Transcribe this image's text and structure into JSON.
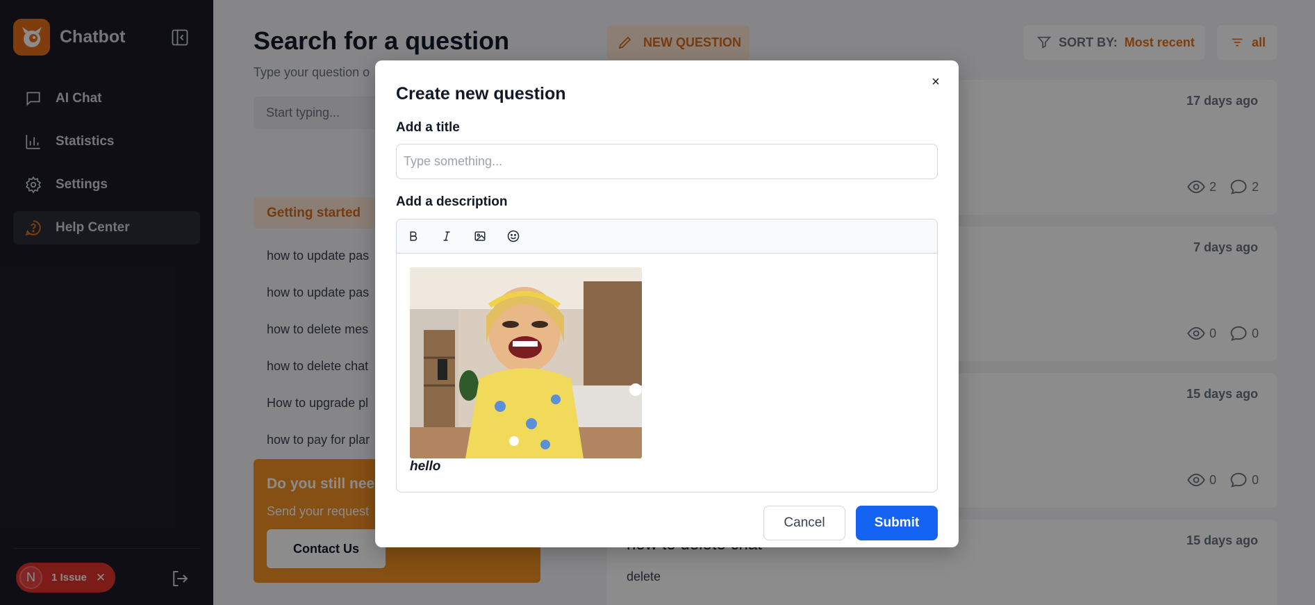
{
  "sidebar": {
    "brand": "Chatbot",
    "items": [
      {
        "label": "AI Chat",
        "icon": "chat-icon"
      },
      {
        "label": "Statistics",
        "icon": "chart-icon"
      },
      {
        "label": "Settings",
        "icon": "gear-icon"
      },
      {
        "label": "Help Center",
        "icon": "help-icon",
        "active": true
      }
    ],
    "issue_badge": {
      "avatar_letter": "N",
      "label": "1 Issue",
      "close": "✕"
    }
  },
  "main": {
    "title": "Search for a question",
    "subtitle": "Type your question o",
    "search_placeholder": "Start typing...",
    "new_question_label": "NEW QUESTION",
    "sort_label": "SORT BY:",
    "sort_value": "Most recent",
    "filter_label": "all",
    "category_title": "Getting started",
    "category_items": [
      "how to update pas",
      "how to update pas",
      "how to delete mes",
      "how to delete chat",
      "How to upgrade pl",
      "how to pay for plar"
    ],
    "help_card": {
      "title": "Do you still need",
      "subtitle": "Send your request",
      "button": "Contact Us"
    },
    "questions": [
      {
        "title": "",
        "desc": "",
        "date": "17 days ago",
        "views": "2",
        "comments": "2"
      },
      {
        "title": "",
        "desc": "",
        "date": "7 days ago",
        "views": "0",
        "comments": "0"
      },
      {
        "title": "",
        "desc": "",
        "date": "15 days ago",
        "views": "0",
        "comments": "0"
      },
      {
        "title": "how to delete chat",
        "desc": "delete",
        "date": "15 days ago",
        "views": "",
        "comments": ""
      }
    ]
  },
  "modal": {
    "title": "Create new question",
    "title_label": "Add a title",
    "title_placeholder": "Type something...",
    "description_label": "Add a description",
    "toolbar": [
      "bold-icon",
      "italic-icon",
      "image-icon",
      "emoji-icon"
    ],
    "body_text": "hello",
    "cancel_label": "Cancel",
    "submit_label": "Submit",
    "close_label": "×"
  },
  "colors": {
    "accent": "#e8701a",
    "sidebar_bg": "#1b1b26",
    "primary_button": "#1463f3",
    "issue_badge": "#e0332f"
  }
}
